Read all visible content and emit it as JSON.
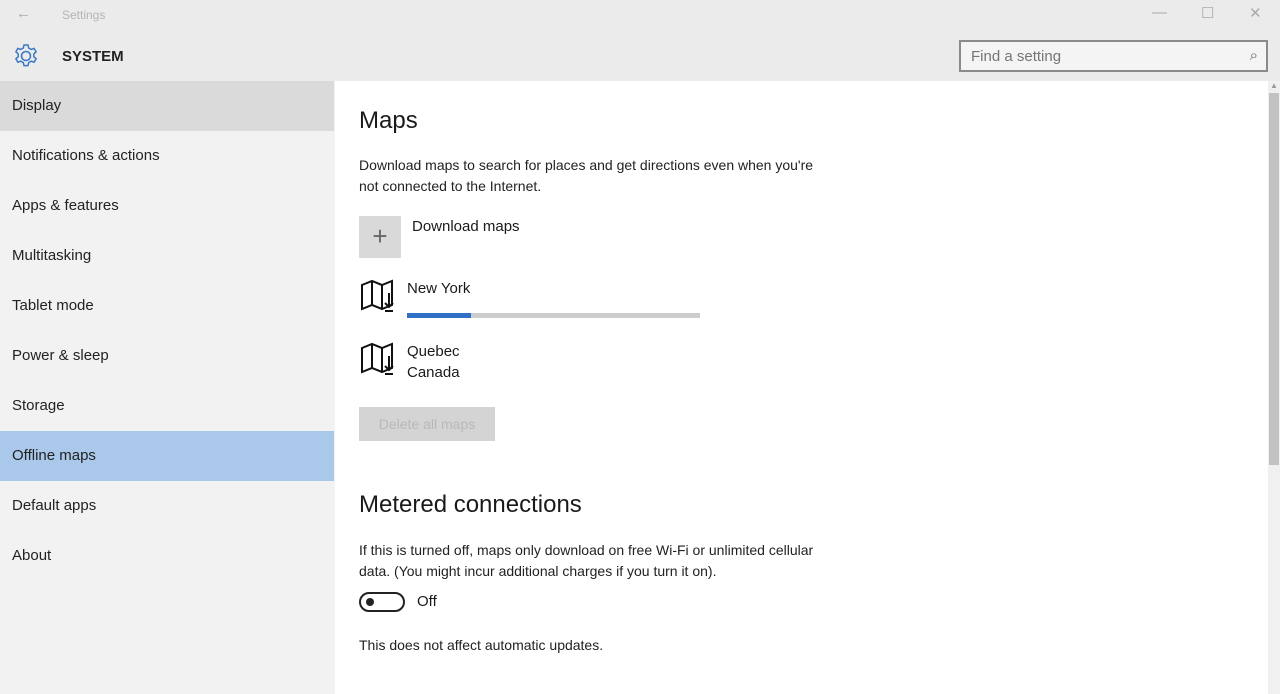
{
  "window": {
    "title": "Settings",
    "back": "←",
    "minimize": "—",
    "maximize": "☐",
    "close": "✕"
  },
  "header": {
    "section": "SYSTEM",
    "search_placeholder": "Find a setting",
    "search_icon": "⌕"
  },
  "sidebar": {
    "items": [
      {
        "label": "Display"
      },
      {
        "label": "Notifications & actions"
      },
      {
        "label": "Apps & features"
      },
      {
        "label": "Multitasking"
      },
      {
        "label": "Tablet mode"
      },
      {
        "label": "Power & sleep"
      },
      {
        "label": "Storage"
      },
      {
        "label": "Offline maps"
      },
      {
        "label": "Default apps"
      },
      {
        "label": "About"
      }
    ]
  },
  "maps": {
    "title": "Maps",
    "description": "Download maps to search for places and get directions even when you're not connected to the Internet.",
    "download_label": "Download maps",
    "plus": "+",
    "items": [
      {
        "name": "New York",
        "progress_percent": 22
      },
      {
        "name": "Quebec",
        "sub": "Canada"
      }
    ],
    "delete_label": "Delete all maps"
  },
  "metered": {
    "title": "Metered connections",
    "description": "If this is turned off, maps only download on free Wi-Fi or unlimited cellular data. (You might incur additional charges if you turn it on).",
    "toggle_state": "Off",
    "note": "This does not affect automatic updates."
  },
  "colors": {
    "accent": "#2f6fc5",
    "selected": "#a9c8ea"
  }
}
